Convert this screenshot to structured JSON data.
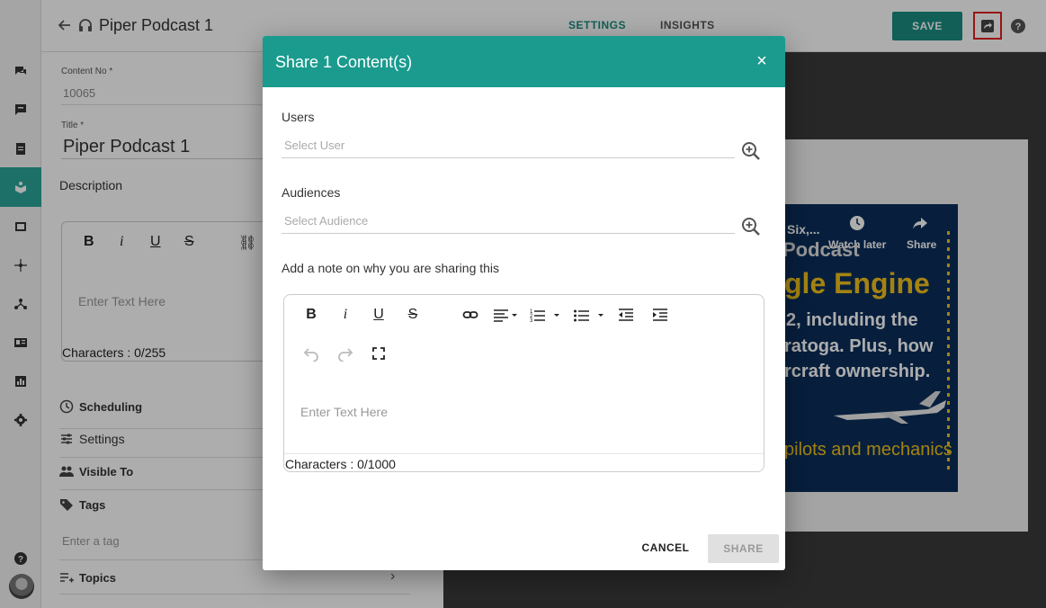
{
  "header": {
    "title": "Piper Podcast 1",
    "tabs": [
      {
        "label": "SETTINGS"
      },
      {
        "label": "INSIGHTS"
      }
    ],
    "save_label": "SAVE"
  },
  "form": {
    "content_no_label": "Content No *",
    "content_no_value": "10065",
    "title_label": "Title *",
    "title_value": "Piper Podcast 1",
    "description_label": "Description",
    "editor_placeholder": "Enter Text Here",
    "editor_chars": "Characters : 0/255",
    "sections": {
      "scheduling": "Scheduling",
      "settings": "Settings",
      "visible_to": "Visible To",
      "tags": "Tags",
      "tag_placeholder": "Enter a tag",
      "topics": "Topics"
    }
  },
  "preview": {
    "video_title": "Six,...",
    "watch_later": "Watch later",
    "share": "Share",
    "line1": "Podcast",
    "line2": "gle Engine",
    "line3": "2, including the",
    "line4": "ratoga. Plus, how",
    "line5": "rcraft ownership.",
    "line6": "pilots and mechanics"
  },
  "dialog": {
    "title": "Share 1 Content(s)",
    "close_symbol": "×",
    "users_label": "Users",
    "users_placeholder": "Select User",
    "audiences_label": "Audiences",
    "audiences_placeholder": "Select Audience",
    "note_label": "Add a note on why you are sharing this",
    "note_placeholder": "Enter Text Here",
    "note_chars": "Characters : 0/1000",
    "cancel_label": "CANCEL",
    "share_label": "SHARE"
  },
  "colors": {
    "accent": "#1a9b8e",
    "save_button": "#1a8c80",
    "highlight_border": "#e02020"
  }
}
